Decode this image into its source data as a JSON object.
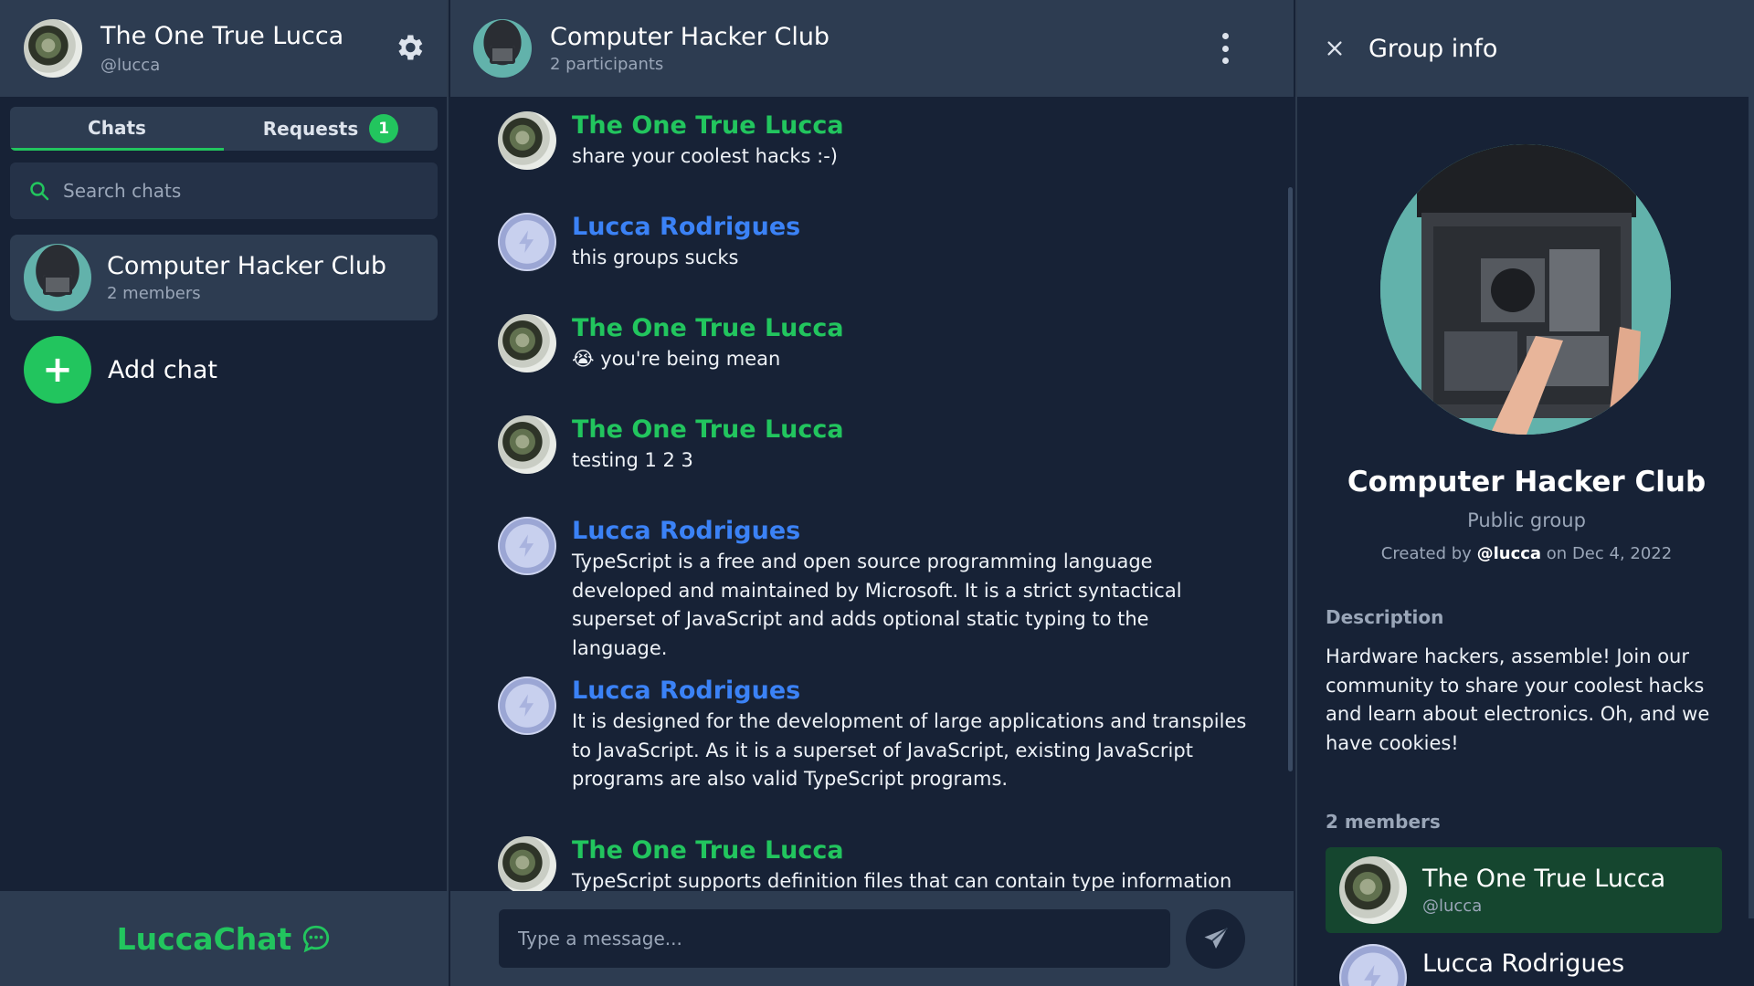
{
  "user": {
    "name": "The One True Lucca",
    "handle": "@lucca"
  },
  "tabs": {
    "chats": "Chats",
    "requests": "Requests",
    "requests_count": "1"
  },
  "search": {
    "placeholder": "Search chats"
  },
  "chat_list": [
    {
      "title": "Computer Hacker Club",
      "subtitle": "2 members"
    }
  ],
  "add_chat_label": "Add chat",
  "brand": "LuccaChat",
  "chat": {
    "title": "Computer Hacker Club",
    "subtitle": "2 participants",
    "composer_placeholder": "Type a message...",
    "messages": [
      {
        "sender": "The One True Lucca",
        "text": "share your coolest hacks :-)"
      },
      {
        "sender": "Lucca Rodrigues",
        "text": "this groups sucks"
      },
      {
        "sender": "The One True Lucca",
        "text": "😭 you're being mean"
      },
      {
        "sender": "The One True Lucca",
        "text": "testing 1 2 3"
      },
      {
        "sender": "Lucca Rodrigues",
        "text": "TypeScript is a free and open source programming language developed and maintained by Microsoft. It is a strict syntactical superset of JavaScript and adds optional static typing to the language."
      },
      {
        "sender": "Lucca Rodrigues",
        "text": "It is designed for the development of large applications and transpiles to JavaScript. As it is a superset of JavaScript, existing JavaScript programs are also valid TypeScript programs."
      },
      {
        "sender": "The One True Lucca",
        "text": "TypeScript supports definition files that can contain type information"
      }
    ]
  },
  "group_info": {
    "title": "Group info",
    "name": "Computer Hacker Club",
    "type": "Public group",
    "created_prefix": "Created by",
    "created_by": "@lucca",
    "created_on": "on Dec 4, 2022",
    "description_label": "Description",
    "description": "Hardware hackers, assemble! Join our community to share your coolest hacks and learn about electronics. Oh, and we have cookies!",
    "members_label": "2 members",
    "members": [
      {
        "name": "The One True Lucca",
        "handle": "@lucca"
      },
      {
        "name": "Lucca Rodrigues"
      }
    ]
  },
  "colors": {
    "accent": "#22c55e",
    "link": "#3b82f6",
    "panel": "#2d3c51",
    "background": "#172236"
  }
}
